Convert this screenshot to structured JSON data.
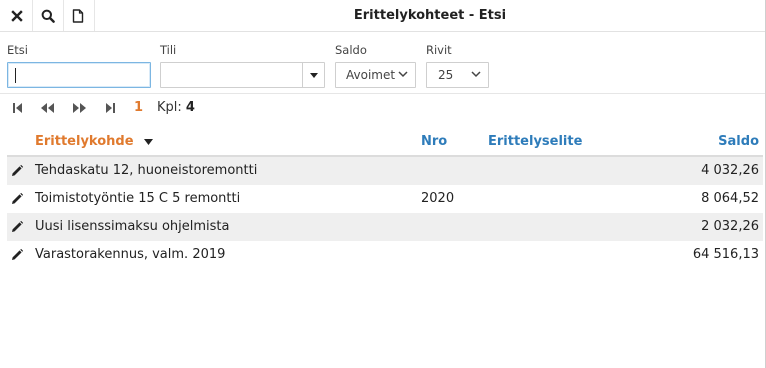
{
  "toolbar": {
    "close_icon": "close-icon",
    "search_icon": "search-icon",
    "new_icon": "document-icon"
  },
  "window": {
    "title": "Erittelykohteet - Etsi"
  },
  "filters": {
    "etsi": {
      "label": "Etsi",
      "value": ""
    },
    "tili": {
      "label": "Tili",
      "value": ""
    },
    "saldo": {
      "label": "Saldo",
      "value": "Avoimet"
    },
    "rivit": {
      "label": "Rivit",
      "value": "25"
    }
  },
  "pager": {
    "page": "1",
    "count_label": "Kpl:",
    "count_value": "4"
  },
  "table": {
    "columns": {
      "erittelykohde": "Erittelykohde",
      "nro": "Nro",
      "erittelyselite": "Erittelyselite",
      "saldo": "Saldo"
    },
    "rows": [
      {
        "erittelykohde": "Tehdaskatu 12, huoneistoremontti",
        "nro": "",
        "erittelyselite": "",
        "saldo": "4 032,26"
      },
      {
        "erittelykohde": "Toimistotyöntie 15 C 5 remontti",
        "nro": "2020",
        "erittelyselite": "",
        "saldo": "8 064,52"
      },
      {
        "erittelykohde": "Uusi lisenssimaksu ohjelmista",
        "nro": "",
        "erittelyselite": "",
        "saldo": "2 032,26"
      },
      {
        "erittelykohde": "Varastorakennus, valm. 2019",
        "nro": "",
        "erittelyselite": "",
        "saldo": "64 516,13"
      }
    ]
  },
  "colors": {
    "accent_blue": "#2e7cba",
    "accent_orange": "#e07a2e",
    "row_alt": "#efefef"
  }
}
